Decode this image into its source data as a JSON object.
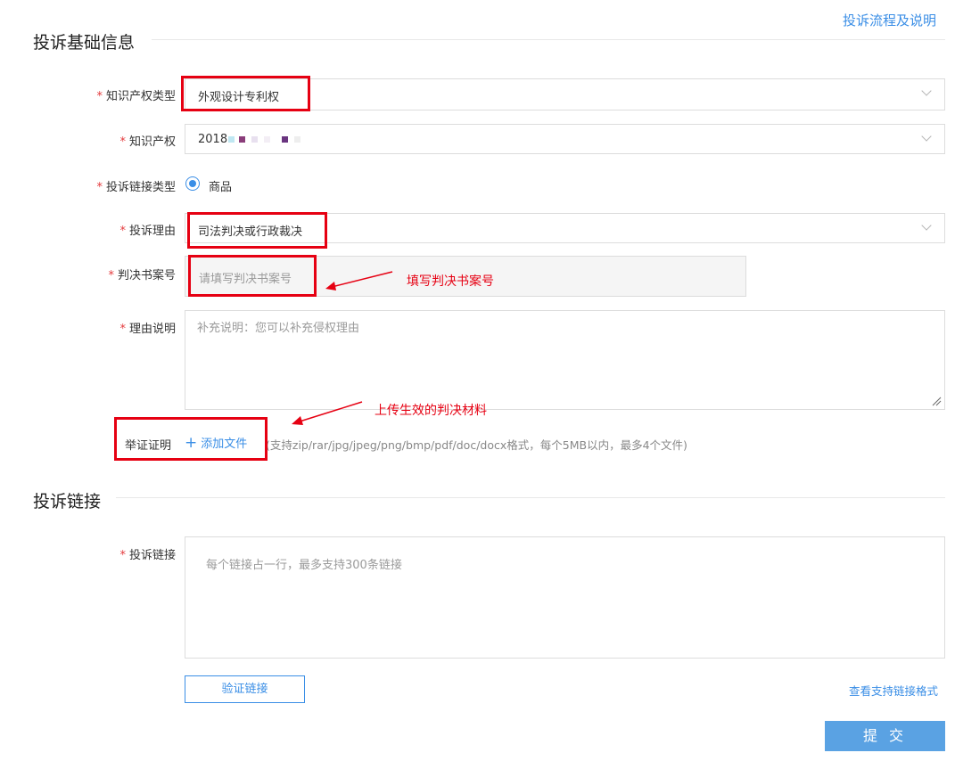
{
  "header": {
    "help_link": "投诉流程及说明"
  },
  "section1": {
    "title": "投诉基础信息",
    "ip_type": {
      "label": "知识产权类型",
      "value": "外观设计专利权"
    },
    "ip": {
      "label": "知识产权",
      "value": "2018"
    },
    "link_type": {
      "label": "投诉链接类型",
      "option": "商品"
    },
    "reason": {
      "label": "投诉理由",
      "value": "司法判决或行政裁决"
    },
    "judgment_no": {
      "label": "判决书案号",
      "placeholder": "请填写判决书案号"
    },
    "reason_desc": {
      "label": "理由说明",
      "placeholder": "补充说明：您可以补充侵权理由"
    },
    "evidence": {
      "label": "举证证明",
      "add_file": "添加文件",
      "hint": "(支持zip/rar/jpg/jpeg/png/bmp/pdf/doc/docx格式，每个5MB以内，最多4个文件)"
    },
    "annotations": {
      "judgment": "填写判决书案号",
      "upload": "上传生效的判决材料"
    }
  },
  "section2": {
    "title": "投诉链接",
    "links": {
      "label": "投诉链接",
      "placeholder": "每个链接占一行，最多支持300条链接"
    },
    "verify_button": "验证链接",
    "format_link": "查看支持链接格式",
    "submit_button": "提 交"
  },
  "colors": {
    "accent": "#3a8ee6",
    "annotation_red": "#e60012",
    "required_star": "#e4393c"
  },
  "icons": [
    "chevron-down-icon",
    "radio-selected-icon",
    "plus-icon",
    "resize-handle-icon",
    "arrow-icon"
  ]
}
